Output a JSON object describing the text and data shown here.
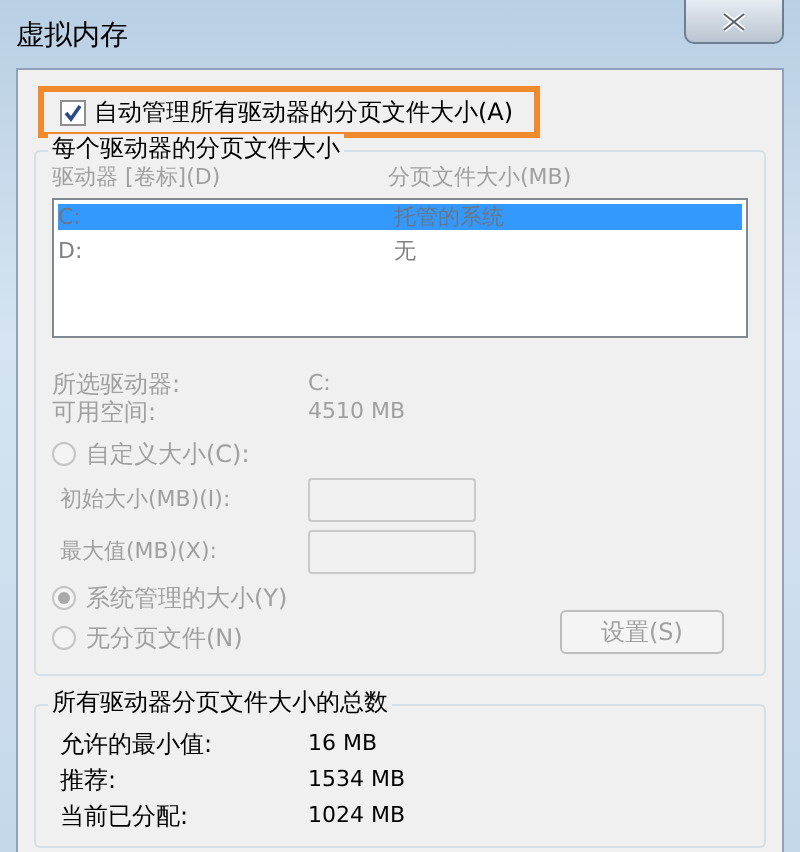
{
  "window": {
    "title": "虚拟内存"
  },
  "auto_manage": {
    "label": "自动管理所有驱动器的分页文件大小(A)",
    "checked": true,
    "highlighted": true
  },
  "per_drive": {
    "title": "每个驱动器的分页文件大小",
    "disabled": true,
    "columns": [
      "驱动器 [卷标](D)",
      "分页文件大小(MB)"
    ],
    "rows": [
      {
        "drive": "C:",
        "size": "托管的系统",
        "selected": true
      },
      {
        "drive": "D:",
        "size": "无",
        "selected": false
      }
    ],
    "info": [
      {
        "label": "所选驱动器:",
        "value": "C:"
      },
      {
        "label": "可用空间:",
        "value": "4510 MB"
      }
    ],
    "options": [
      {
        "kind": "radio",
        "label": "自定义大小(C):",
        "selected": false
      },
      {
        "kind": "field",
        "label": "初始大小(MB)(I):"
      },
      {
        "kind": "field",
        "label": "最大值(MB)(X):"
      },
      {
        "kind": "radio",
        "label": "系统管理的大小(Y)",
        "selected": true
      },
      {
        "kind": "radio",
        "label": "无分页文件(N)",
        "selected": false
      }
    ],
    "set_button": "设置(S)"
  },
  "totals": {
    "title": "所有驱动器分页文件大小的总数",
    "rows": [
      {
        "label": "允许的最小值:",
        "value": "16 MB"
      },
      {
        "label": "推荐:",
        "value": "1534 MB"
      },
      {
        "label": "当前已分配:",
        "value": "1024 MB"
      }
    ]
  }
}
